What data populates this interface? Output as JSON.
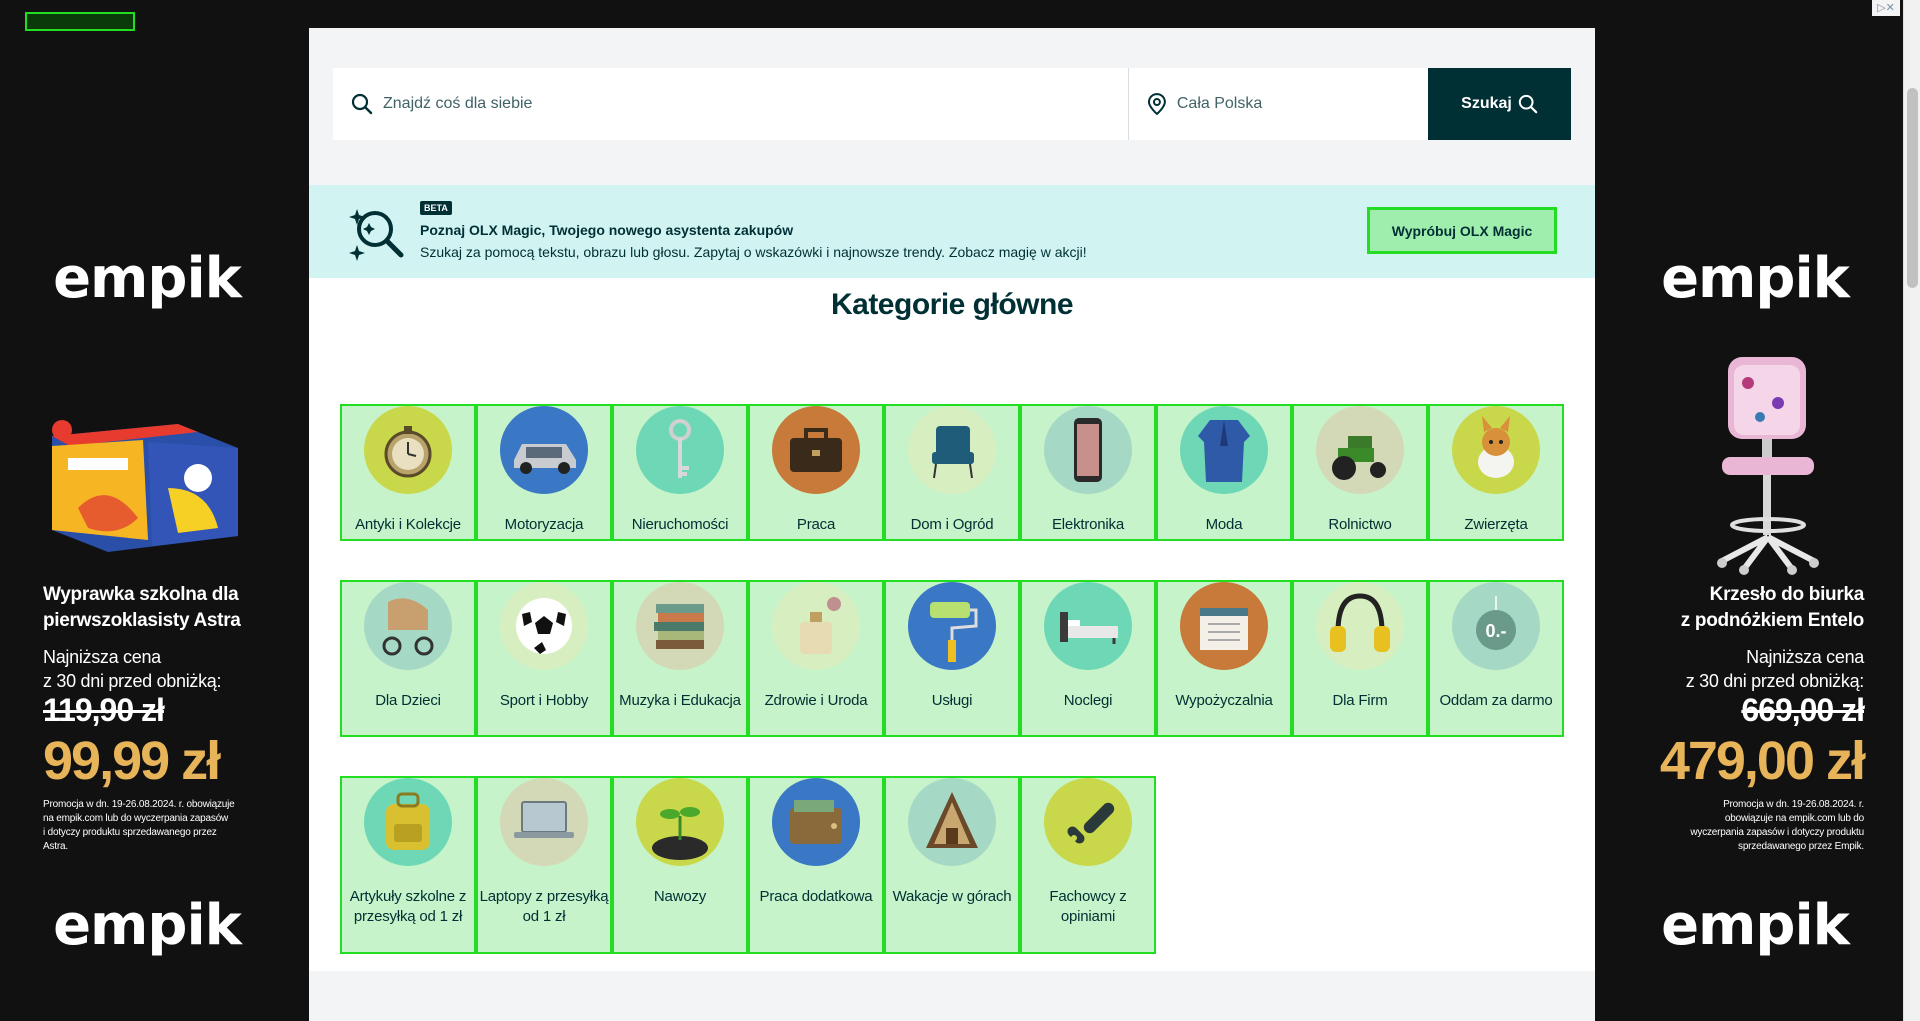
{
  "search": {
    "placeholder": "Znajdź coś dla siebie",
    "location_placeholder": "Cała Polska",
    "button_label": "Szukaj"
  },
  "magic": {
    "badge": "BETA",
    "title": "Poznaj OLX Magic, Twojego nowego asystenta zakupów",
    "description": "Szukaj za pomocą tekstu, obrazu lub głosu. Zapytaj o wskazówki i najnowsze trendy. Zobacz magię w akcji!",
    "button_label": "Wypróbuj OLX Magic"
  },
  "categories_heading": "Kategorie główne",
  "categories": [
    {
      "label": "Antyki i Kolekcje",
      "color": "#c8d84a",
      "icon": "pocket-watch-icon"
    },
    {
      "label": "Motoryzacja",
      "color": "#3a77c4",
      "icon": "car-icon"
    },
    {
      "label": "Nieruchomości",
      "color": "#6ed8b6",
      "icon": "key-icon"
    },
    {
      "label": "Praca",
      "color": "#c77a3a",
      "icon": "briefcase-icon"
    },
    {
      "label": "Dom i Ogród",
      "color": "#d7efc0",
      "icon": "armchair-icon"
    },
    {
      "label": "Elektronika",
      "color": "#a5d8c5",
      "icon": "smartphone-icon"
    },
    {
      "label": "Moda",
      "color": "#6ed8b6",
      "icon": "robe-icon"
    },
    {
      "label": "Rolnictwo",
      "color": "#d3d8b6",
      "icon": "tractor-icon"
    },
    {
      "label": "Zwierzęta",
      "color": "#c8d84a",
      "icon": "dog-icon"
    },
    {
      "label": "Dla Dzieci",
      "color": "#a5d8c5",
      "icon": "stroller-icon"
    },
    {
      "label": "Sport i Hobby",
      "color": "#d7efc0",
      "icon": "football-icon"
    },
    {
      "label": "Muzyka i Edukacja",
      "color": "#d3d8b6",
      "icon": "books-icon"
    },
    {
      "label": "Zdrowie i Uroda",
      "color": "#d7efc0",
      "icon": "perfume-icon"
    },
    {
      "label": "Usługi",
      "color": "#3a77c4",
      "icon": "paint-roller-icon"
    },
    {
      "label": "Noclegi",
      "color": "#6ed8b6",
      "icon": "bed-icon"
    },
    {
      "label": "Wypożyczalnia",
      "color": "#c77a3a",
      "icon": "calendar-icon"
    },
    {
      "label": "Dla Firm",
      "color": "#d7efc0",
      "icon": "ear-protectors-icon"
    },
    {
      "label": "Oddam za darmo",
      "color": "#a5d8c5",
      "icon": "free-tag-icon"
    },
    {
      "label": "Artykuły szkolne z przesyłką od 1 zł",
      "color": "#6ed8b6",
      "icon": "backpack-icon"
    },
    {
      "label": "Laptopy z przesyłką od 1 zł",
      "color": "#d3d8b6",
      "icon": "laptop-icon"
    },
    {
      "label": "Nawozy",
      "color": "#c8d84a",
      "icon": "sprout-icon"
    },
    {
      "label": "Praca dodatkowa",
      "color": "#3a77c4",
      "icon": "wallet-icon"
    },
    {
      "label": "Wakacje w górach",
      "color": "#a5d8c5",
      "icon": "mountain-cabin-icon"
    },
    {
      "label": "Fachowcy z opiniami",
      "color": "#c8d84a",
      "icon": "checkmark-icon"
    }
  ],
  "ad_left": {
    "brand": "empik",
    "product": "Wyprawka szkolna dla pierwszoklasisty Astra",
    "product_line1": "Wyprawka szkolna dla",
    "product_line2": "pierwszoklasisty Astra",
    "lowest_line1": "Najniższa cena",
    "lowest_line2": "z 30 dni przed obniżką:",
    "old_price": "119,90 zł",
    "new_price": "99,99 zł",
    "promo_line1": "Promocja w dn. 19-26.08.2024. r. obowiązuje",
    "promo_line2": "na empik.com lub do wyczerpania zapasów",
    "promo_line3": "i dotyczy produktu sprzedawanego przez",
    "promo_line4": "Astra.",
    "brand_bottom": "empik"
  },
  "ad_right": {
    "brand": "empik",
    "product_line1": "Krzesło do biurka",
    "product_line2": "z podnóżkiem Entelo",
    "lowest_line1": "Najniższa cena",
    "lowest_line2": "z 30 dni przed obniżką:",
    "old_price": "669,00 zł",
    "new_price": "479,00 zł",
    "promo_line1": "Promocja w dn. 19-26.08.2024. r.",
    "promo_line2": "obowiązuje na empik.com lub do",
    "promo_line3": "wyczerpania zapasów i dotyczy produktu",
    "promo_line4": "sprzedawanego przez Empik.",
    "brand_bottom": "empik"
  },
  "adchoices_label": "▷✕",
  "colors": {
    "olx_dark": "#002f34",
    "magic_bg": "#d1f4f3",
    "highlight": "#22dd22",
    "price_gold": "#e7b45a"
  }
}
